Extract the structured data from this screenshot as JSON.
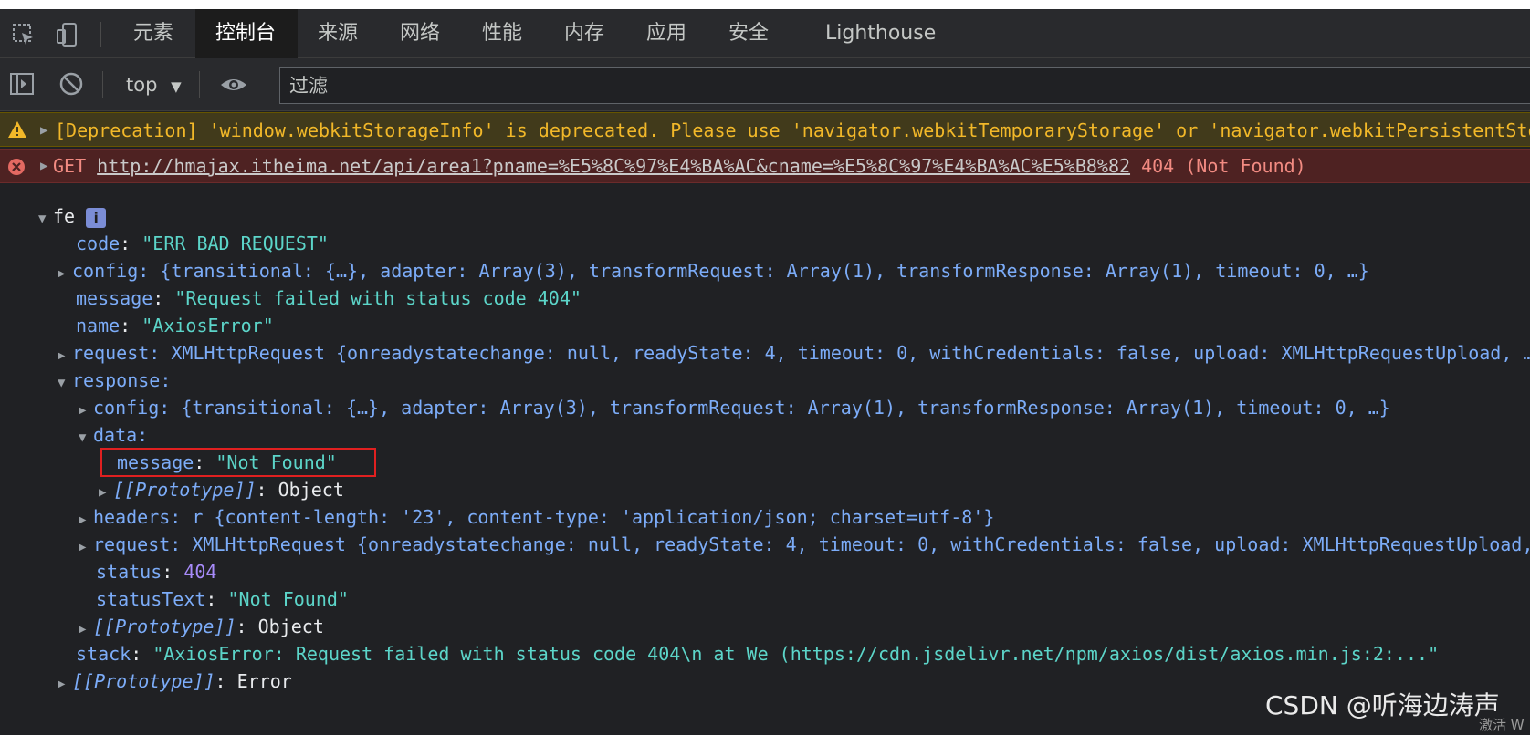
{
  "tabs": [
    "元素",
    "控制台",
    "来源",
    "网络",
    "性能",
    "内存",
    "应用",
    "安全",
    "Lighthouse"
  ],
  "toolbar": {
    "context": "top",
    "filter_placeholder": "过滤"
  },
  "warning": {
    "text": "[Deprecation] 'window.webkitStorageInfo' is deprecated. Please use 'navigator.webkitTemporaryStorage' or 'navigator.webkitPersistentStorage' instead."
  },
  "error": {
    "method": "GET",
    "url": "http://hmajax.itheima.net/api/area1?pname=%E5%8C%97%E4%BA%AC&cname=%E5%8C%97%E4%BA%AC%E5%B8%82",
    "status": "404 (Not Found)"
  },
  "tree": {
    "root": "fe",
    "code_key": "code",
    "code_val": "\"ERR_BAD_REQUEST\"",
    "config_line": "config: {transitional: {…}, adapter: Array(3), transformRequest: Array(1), transformResponse: Array(1), timeout: 0, …}",
    "message_key": "message",
    "message_val": "\"Request failed with status code 404\"",
    "name_key": "name",
    "name_val": "\"AxiosError\"",
    "request_line": "request: XMLHttpRequest {onreadystatechange: null, readyState: 4, timeout: 0, withCredentials: false, upload: XMLHttpRequestUpload, …}",
    "response_key": "response:",
    "resp_config_line": "config: {transitional: {…}, adapter: Array(3), transformRequest: Array(1), transformResponse: Array(1), timeout: 0, …}",
    "data_key": "data:",
    "data_message_key": "message",
    "data_message_val": "\"Not Found\"",
    "proto_key": "[[Prototype]]",
    "proto_object": "Object",
    "headers_line": "headers: r {content-length: '23', content-type: 'application/json; charset=utf-8'}",
    "resp_request_line": "request: XMLHttpRequest {onreadystatechange: null, readyState: 4, timeout: 0, withCredentials: false, upload: XMLHttpRequestUpload, …}",
    "status_key": "status",
    "status_val": "404",
    "statustext_key": "statusText",
    "statustext_val": "\"Not Found\"",
    "stack_key": "stack",
    "stack_val": "\"AxiosError: Request failed with status code 404\\n    at We (https://cdn.jsdelivr.net/npm/axios/dist/axios.min.js:2:...\"",
    "proto_error": "Error"
  },
  "watermark": "CSDN @听海边涛声",
  "activate_text": "激活 W"
}
